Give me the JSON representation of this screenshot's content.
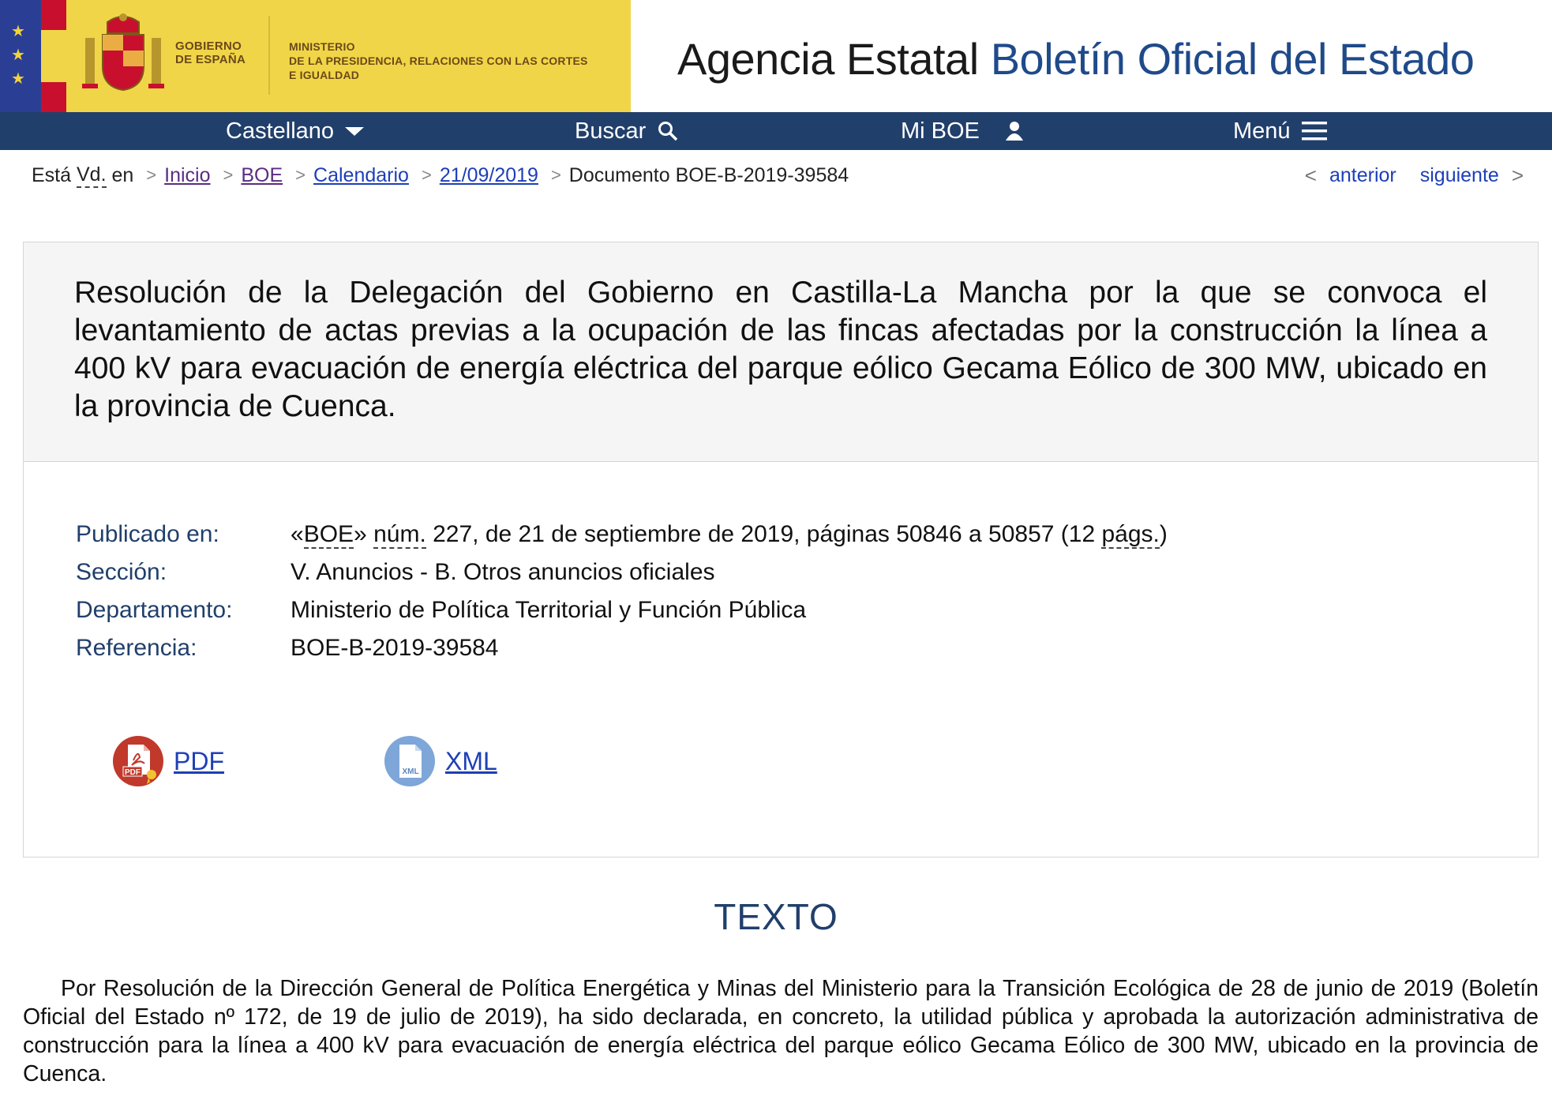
{
  "header": {
    "gov_line1": "GOBIERNO",
    "gov_line2": "DE ESPAÑA",
    "min_line1": "MINISTERIO",
    "min_line2": "DE LA PRESIDENCIA, RELACIONES CON LAS CORTES",
    "min_line3": "E IGUALDAD",
    "agency_prefix": "Agencia Estatal",
    "agency_name": "Boletín Oficial del Estado"
  },
  "nav": {
    "language": "Castellano",
    "search": "Buscar",
    "my_boe": "Mi BOE",
    "menu": "Menú"
  },
  "breadcrumb": {
    "prefix_1": "Está",
    "prefix_abbr": "Vd.",
    "prefix_2": "en",
    "items": [
      "Inicio",
      "BOE",
      "Calendario",
      "21/09/2019"
    ],
    "current": "Documento BOE-B-2019-39584"
  },
  "pager": {
    "previous": "anterior",
    "next": "siguiente"
  },
  "document": {
    "title": "Resolución de la Delegación del Gobierno en Castilla-La Mancha por la que se convoca el levantamiento de actas previas a la ocupación de las fincas afectadas por la construcción la línea a 400 kV para evacuación de energía eléctrica del parque eólico Gecama Eólico de 300 MW, ubicado en la provincia de Cuenca.",
    "published_label": "Publicado en:",
    "published_open_quote": "«",
    "published_boe": "BOE",
    "published_close_quote": "»",
    "published_num": "núm.",
    "published_middle": "227, de 21 de septiembre de 2019, páginas 50846 a 50857 (12",
    "published_pags": "págs.",
    "published_end": ")",
    "section_label": "Sección:",
    "section_value": "V. Anuncios - B. Otros anuncios oficiales",
    "department_label": "Departamento:",
    "department_value": "Ministerio de Política Territorial y Función Pública",
    "reference_label": "Referencia:",
    "reference_value": "BOE-B-2019-39584",
    "pdf_label": "PDF",
    "pdf_icon_text": "PDF",
    "xml_label": "XML",
    "xml_icon_text": "XML"
  },
  "texto": {
    "heading": "TEXTO",
    "paragraph": "Por Resolución de la Dirección General de Política Energética y Minas del Ministerio para la Transición Ecológica de 28 de junio de 2019 (Boletín Oficial del Estado nº 172, de 19 de julio de 2019), ha sido declarada, en concreto, la utilidad pública y aprobada la autorización administrativa de construcción para la línea a 400 kV para evacuación de energía eléctrica del parque eólico Gecama Eólico de 300 MW, ubicado en la provincia de Cuenca."
  },
  "colors": {
    "navbar": "#213f6b",
    "gov_yellow": "#f1d548",
    "eu_blue": "#2a3f94",
    "link_blue": "#1d3fb8",
    "visited_purple": "#5a2d82",
    "pdf_red": "#c0392b",
    "xml_blue": "#7ea6d8"
  }
}
